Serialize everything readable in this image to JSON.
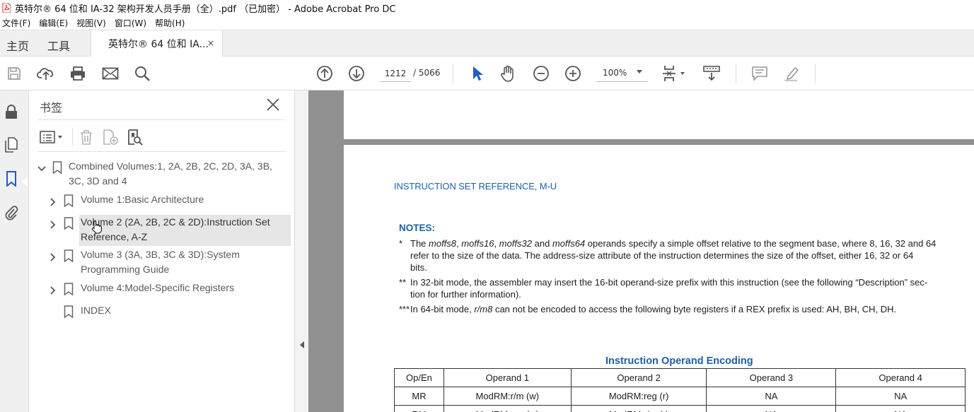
{
  "window": {
    "title": "英特尔® 64 位和 IA-32 架构开发人员手册（全）.pdf （已加密） - Adobe Acrobat Pro DC"
  },
  "menu": [
    "文件(F)",
    "编辑(E)",
    "视图(V)",
    "窗口(W)",
    "帮助(H)"
  ],
  "tabs": {
    "home": "主页",
    "tools": "工具",
    "document": "英特尔® 64 位和 IA...",
    "close": "×"
  },
  "toolbar": {
    "page_current": "1212",
    "page_total": "/ 5066",
    "zoom": "100%"
  },
  "bookmarks": {
    "title": "书签",
    "items": [
      {
        "label_line1": "Combined Volumes:1, 2A, 2B, 2C, 2D, 3A, 3B,",
        "label_line2": "3C, 3D and 4"
      },
      {
        "label_line1": "Volume 1:Basic Architecture"
      },
      {
        "label_line1": "Volume 2 (2A, 2B, 2C & 2D):Instruction Set",
        "label_line2": "Reference, A-Z"
      },
      {
        "label_line1": "Volume 3 (3A, 3B, 3C & 3D):System",
        "label_line2": "Programming Guide"
      },
      {
        "label_line1": "Volume 4:Model-Specific Registers"
      },
      {
        "label_line1": "INDEX"
      }
    ]
  },
  "page": {
    "header": "INSTRUCTION SET REFERENCE, M-U",
    "notes_title": "NOTES:",
    "notes": [
      {
        "mark": "*",
        "line1_pre": "The ",
        "line1_i1": "moffs8",
        "line1_c1": ", ",
        "line1_i2": "moffs16",
        "line1_c2": ", ",
        "line1_i3": "moffs32",
        "line1_c3": " and ",
        "line1_i4": "moffs64",
        "line1_post": " operands specify a simple offset relative to the segment base, where 8, 16, 32 and 64",
        "line2": "refer to the size of the data. The address-size attribute of the instruction determines the size of the offset, either 16, 32 or 64",
        "line3": "bits."
      },
      {
        "mark": "**",
        "line1": "In 32-bit mode, the assembler may insert the 16-bit operand-size prefix with this instruction (see the following “Description” sec-",
        "line2": "tion for further information)."
      },
      {
        "mark": "***",
        "line1_pre": "In 64-bit mode, ",
        "line1_i": "r/m8",
        "line1_post": " can not be encoded to access the following byte registers if a REX prefix is used: AH, BH, CH, DH."
      }
    ],
    "encoding_title": "Instruction Operand Encoding",
    "table": {
      "headers": [
        "Op/En",
        "Operand 1",
        "Operand 2",
        "Operand 3",
        "Operand 4"
      ],
      "rows": [
        [
          "MR",
          "ModRM:r/m (w)",
          "ModRM:reg (r)",
          "NA",
          "NA"
        ],
        [
          "RM",
          "ModRM:reg (w)",
          "ModRM:r/m (r)",
          "NA",
          "NA"
        ]
      ]
    }
  }
}
